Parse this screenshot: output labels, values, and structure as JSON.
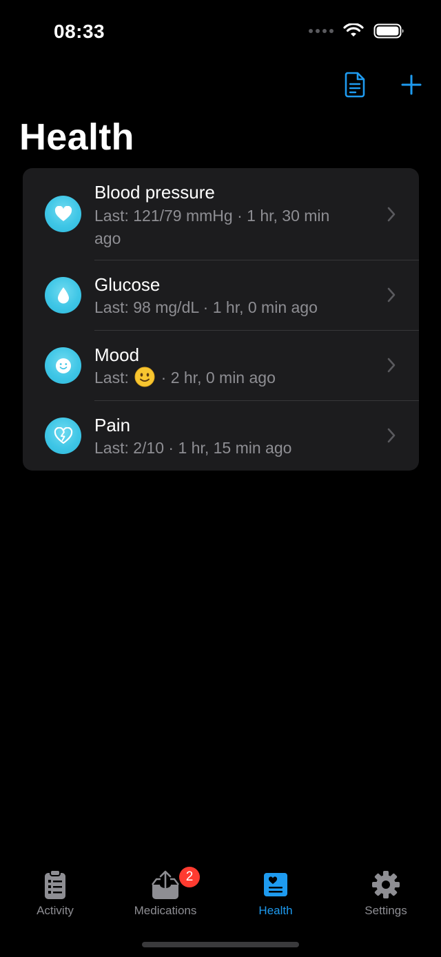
{
  "status_bar": {
    "time": "08:33"
  },
  "nav": {
    "title": "Health",
    "report_icon": "document-icon",
    "add_icon": "plus-icon"
  },
  "colors": {
    "accent": "#1e9bf0",
    "icon_teal": "#3fc6e6",
    "badge_red": "#ff3b30",
    "secondary_text": "#8e8e93",
    "card_bg": "#1c1c1e"
  },
  "rows": [
    {
      "title": "Blood pressure",
      "subtitle": "Last: 121/79 mmHg · 1 hr, 30 min ago",
      "icon": "heart-icon"
    },
    {
      "title": "Glucose",
      "subtitle": "Last: 98 mg/dL · 1 hr, 0 min ago",
      "icon": "drop-icon"
    },
    {
      "title": "Mood",
      "subtitle_prefix": "Last:",
      "subtitle_emoji": "🙂",
      "subtitle_suffix": "· 2 hr, 0 min ago",
      "icon": "smile-icon"
    },
    {
      "title": "Pain",
      "subtitle": "Last: 2/10 · 1 hr, 15 min ago",
      "icon": "broken-heart-icon"
    }
  ],
  "tabs": [
    {
      "label": "Activity",
      "icon": "clipboard-icon",
      "active": false
    },
    {
      "label": "Medications",
      "icon": "tray-upload-icon",
      "badge": "2",
      "active": false
    },
    {
      "label": "Health",
      "icon": "health-card-icon",
      "active": true
    },
    {
      "label": "Settings",
      "icon": "gear-icon",
      "active": false
    }
  ]
}
